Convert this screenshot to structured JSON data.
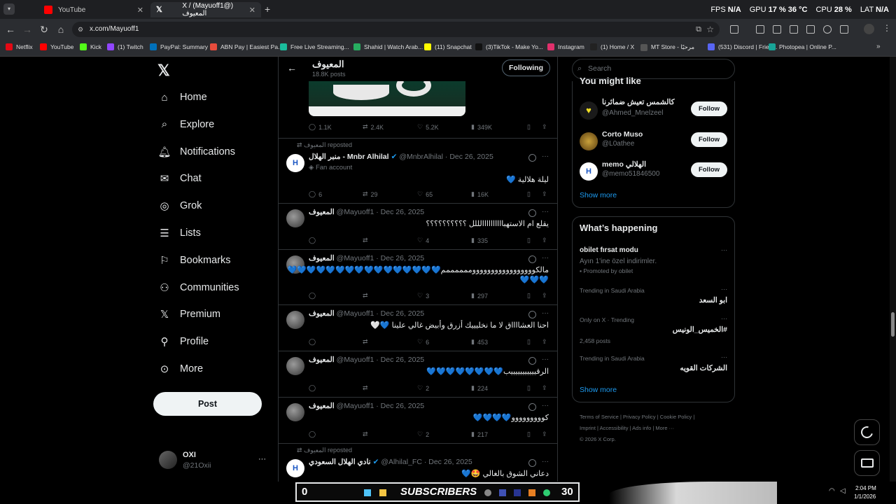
{
  "browser": {
    "tabs": [
      {
        "label": "",
        "icon": "app-icon",
        "color": "#c0392b"
      },
      {
        "label": "YouTube",
        "icon": "youtube-icon",
        "color": "#ff0000"
      },
      {
        "label": "X / (Mayuoff1@) المعيوف",
        "icon": "x-icon",
        "color": "#ffffff"
      }
    ],
    "new_tab": "+",
    "perf": {
      "fps_label": "FPS",
      "fps_value": "N/A",
      "gpu_label": "GPU",
      "gpu_value": "17 %",
      "gpu_temp": "36 °C",
      "cpu_label": "CPU",
      "cpu_value": "28 %",
      "lat_label": "LAT",
      "lat_value": "N/A"
    },
    "url": "x.com/Mayuoff1",
    "bookmarks": [
      {
        "label": "Netflix",
        "color": "#e50914"
      },
      {
        "label": "YouTube",
        "color": "#ff0000"
      },
      {
        "label": "Kick",
        "color": "#53fc18"
      },
      {
        "label": "(1) Twitch",
        "color": "#9146ff"
      },
      {
        "label": "PayPal: Summary",
        "color": "#0070ba"
      },
      {
        "label": "ABN Pay | Easiest Pa...",
        "color": "#e74c3c"
      },
      {
        "label": "Free Live Streaming...",
        "color": "#1abc9c"
      },
      {
        "label": "Shahid | Watch Arab...",
        "color": "#27ae60"
      },
      {
        "label": "(11) Snapchat",
        "color": "#fffc00"
      },
      {
        "label": "(3)TikTok - Make Yo...",
        "color": "#111111"
      },
      {
        "label": "Instagram",
        "color": "#e1306c"
      },
      {
        "label": "(1) Home / X",
        "color": "#222222"
      },
      {
        "label": "MT Store - مرحبًا",
        "color": "#555555"
      },
      {
        "label": "(531) Discord | Frien...",
        "color": "#5865f2"
      },
      {
        "label": "Photopea | Online P...",
        "color": "#18a497"
      }
    ]
  },
  "nav": {
    "items": [
      {
        "label": "Home",
        "icon": "home-icon"
      },
      {
        "label": "Explore",
        "icon": "search-icon"
      },
      {
        "label": "Notifications",
        "icon": "bell-icon"
      },
      {
        "label": "Chat",
        "icon": "mail-icon"
      },
      {
        "label": "Grok",
        "icon": "grok-icon"
      },
      {
        "label": "Lists",
        "icon": "list-icon"
      },
      {
        "label": "Bookmarks",
        "icon": "bookmark-icon"
      },
      {
        "label": "Communities",
        "icon": "communities-icon"
      },
      {
        "label": "Premium",
        "icon": "x-icon"
      },
      {
        "label": "Profile",
        "icon": "profile-icon"
      },
      {
        "label": "More",
        "icon": "more-icon"
      }
    ],
    "post_label": "Post",
    "account": {
      "name": "OXI",
      "handle": "@21Oxii",
      "menu": "···"
    }
  },
  "profile_header": {
    "name": "المعيوف",
    "posts": "18.8K posts",
    "following_label": "Following"
  },
  "top_tweet_actions": {
    "replies": "1.1K",
    "reposts": "2.4K",
    "likes": "5.2K",
    "views": "349K"
  },
  "tweets": [
    {
      "repost_by": "المعيوف reposted",
      "name": "منبر الهلال - Mnbr Alhilal",
      "handle": "@MnbrAlhilal",
      "date": "Dec 26, 2025",
      "badge": "Fan account",
      "text": "ليلة هلالية 💙",
      "replies": "6",
      "reposts": "29",
      "likes": "65",
      "views": "16K"
    },
    {
      "repost_by": "",
      "name": "المعيوف",
      "handle": "@Mayuoff1",
      "date": "Dec 26, 2025",
      "badge": "",
      "text": "يقلع ام الاستهباااااااااالللل ؟؟؟؟؟؟؟؟؟؟",
      "replies": "",
      "reposts": "",
      "likes": "4",
      "views": "335"
    },
    {
      "repost_by": "",
      "name": "المعيوف",
      "handle": "@Mayuoff1",
      "date": "Dec 26, 2025",
      "badge": "",
      "text": "مالكوووووووووووووووووممممممم💙💙💙💙💙💙💙💙💙💙💙💙💙💙💙💙",
      "text2": "💙💙💙",
      "replies": "",
      "reposts": "",
      "likes": "3",
      "views": "297"
    },
    {
      "repost_by": "",
      "name": "المعيوف",
      "handle": "@Mayuoff1",
      "date": "Dec 26, 2025",
      "badge": "",
      "text": "احنا العشااااق لا ما نخليييك أزرق وأبيض غالي علينا 💙🤍",
      "replies": "",
      "reposts": "",
      "likes": "6",
      "views": "453"
    },
    {
      "repost_by": "",
      "name": "المعيوف",
      "handle": "@Mayuoff1",
      "date": "Dec 26, 2025",
      "badge": "",
      "text": "الرقيييييييييييب💙💙💙💙💙💙💙💙",
      "replies": "",
      "reposts": "",
      "likes": "2",
      "views": "224"
    },
    {
      "repost_by": "",
      "name": "المعيوف",
      "handle": "@Mayuoff1",
      "date": "Dec 26, 2025",
      "badge": "",
      "text": "كووووووووو💙💙💙💙",
      "replies": "",
      "reposts": "",
      "likes": "2",
      "views": "217"
    },
    {
      "repost_by": "المعيوف reposted",
      "name": "نادي الهلال السعودي",
      "handle": "@Alhilal_FC",
      "date": "Dec 26, 2025",
      "badge": "",
      "text": "دعاني الشوق بالغالي 🤩💙",
      "replies": "",
      "reposts": "",
      "likes": "",
      "views": ""
    }
  ],
  "search": {
    "placeholder": "Search"
  },
  "suggestions": {
    "title": "You might like",
    "users": [
      {
        "name": "كالشمس تعيش ضمائرنا",
        "handle": "@Ahmed_Mnelzeel",
        "button": "Follow"
      },
      {
        "name": "Corto Muso",
        "handle": "@L0athee",
        "button": "Follow"
      },
      {
        "name": "memo الهلالي",
        "handle": "@memo51846500",
        "button": "Follow"
      }
    ],
    "show_more": "Show more"
  },
  "happening": {
    "title": "What’s happening",
    "promo": {
      "name": "obilet fırsat modu",
      "desc": "Ayın 1'ine özel indirimler.",
      "promoted": "Promoted by obilet"
    },
    "trends": [
      {
        "meta": "Trending in Saudi Arabia",
        "name": "ابو السعد",
        "posts": ""
      },
      {
        "meta": "Only on X · Trending",
        "name": "#الخميس_الونيس",
        "posts": "2,458 posts"
      },
      {
        "meta": "Trending in Saudi Arabia",
        "name": "الشركات القويه",
        "posts": ""
      }
    ],
    "show_more": "Show more"
  },
  "footer": {
    "links": [
      "Terms of Service",
      "Privacy Policy",
      "Cookie Policy",
      "Imprint",
      "Accessibility",
      "Ads info",
      "More ···"
    ],
    "copyright": "© 2026 X Corp."
  },
  "taskbar": {
    "left_count": "0",
    "banner": "SUBSCRIBERS",
    "right_count": "30",
    "time": "2:04 PM",
    "date": "1/1/2026"
  },
  "colors": {
    "accent": "#1d9bf0",
    "heart_blue": "#5fa8e6",
    "bg": "#000000",
    "border": "#2f3336"
  }
}
